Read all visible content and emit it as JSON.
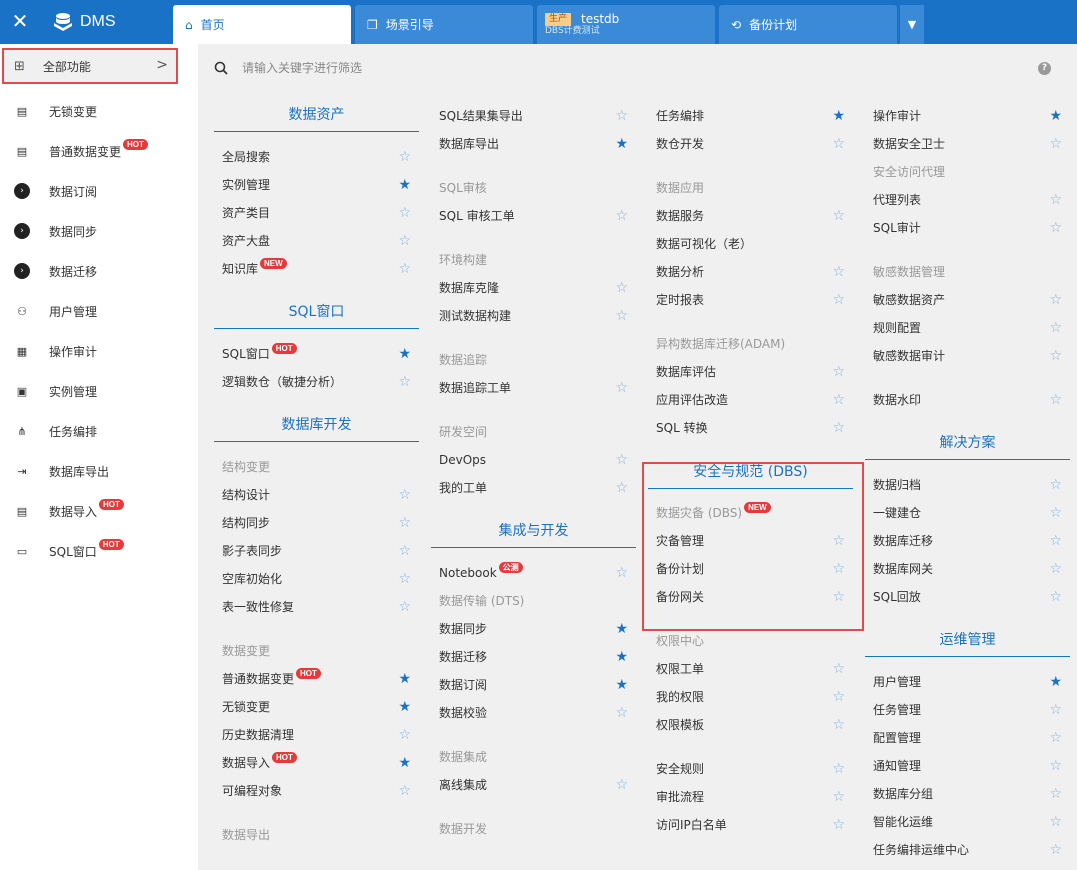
{
  "topbar": {
    "brand": "DMS",
    "tabs": [
      {
        "label": "首页"
      },
      {
        "label": "场景引导"
      },
      {
        "env": "生产",
        "label": "testdb",
        "sub": "DBS计费测试"
      },
      {
        "label": "备份计划"
      }
    ]
  },
  "sidebar": {
    "all_label": "全部功能",
    "items": [
      {
        "label": "无锁变更",
        "badge": ""
      },
      {
        "label": "普通数据变更",
        "badge": "HOT"
      },
      {
        "label": "数据订阅",
        "badge": ""
      },
      {
        "label": "数据同步",
        "badge": ""
      },
      {
        "label": "数据迁移",
        "badge": ""
      },
      {
        "label": "用户管理",
        "badge": ""
      },
      {
        "label": "操作审计",
        "badge": ""
      },
      {
        "label": "实例管理",
        "badge": ""
      },
      {
        "label": "任务编排",
        "badge": ""
      },
      {
        "label": "数据库导出",
        "badge": ""
      },
      {
        "label": "数据导入",
        "badge": "HOT"
      },
      {
        "label": "SQL窗口",
        "badge": "HOT"
      }
    ]
  },
  "search": {
    "placeholder": "请输入关键字进行筛选"
  },
  "colors": {
    "accent": "#1a72c6",
    "hot": "#e53a3a",
    "highlight_border": "#e34b4b"
  },
  "col1": {
    "h1": "数据资产",
    "r1": "全局搜索",
    "r2": "实例管理",
    "r3": "资产类目",
    "r4": "资产大盘",
    "r5": "知识库",
    "h2": "SQL窗口",
    "r6": "SQL窗口",
    "r7": "逻辑数仓（敏捷分析）",
    "h3": "数据库开发",
    "s1": "结构变更",
    "r8": "结构设计",
    "r9": "结构同步",
    "r10": "影子表同步",
    "r11": "空库初始化",
    "r12": "表一致性修复",
    "s2": "数据变更",
    "r13": "普通数据变更",
    "r14": "无锁变更",
    "r15": "历史数据清理",
    "r16": "数据导入",
    "r17": "可编程对象",
    "s3": "数据导出"
  },
  "col2": {
    "r1": "SQL结果集导出",
    "r2": "数据库导出",
    "s1": "SQL审核",
    "r3": "SQL 审核工单",
    "s2": "环境构建",
    "r4": "数据库克隆",
    "r5": "测试数据构建",
    "s3": "数据追踪",
    "r6": "数据追踪工单",
    "s4": "研发空间",
    "r7": "DevOps",
    "r8": "我的工单",
    "h1": "集成与开发",
    "r9": "Notebook",
    "r9badge": "公测",
    "s5": "数据传输 (DTS)",
    "r10": "数据同步",
    "r11": "数据迁移",
    "r12": "数据订阅",
    "r13": "数据校验",
    "s6": "数据集成",
    "r14": "离线集成",
    "s7": "数据开发"
  },
  "col3": {
    "r1": "任务编排",
    "r2": "数仓开发",
    "s1": "数据应用",
    "r3": "数据服务",
    "r4": "数据可视化（老）",
    "r5": "数据分析",
    "r6": "定时报表",
    "s2": "异构数据库迁移(ADAM)",
    "r7": "数据库评估",
    "r8": "应用评估改造",
    "r9": "SQL 转换",
    "h1": "安全与规范 (DBS)",
    "s3": "数据灾备 (DBS)",
    "r10": "灾备管理",
    "r11": "备份计划",
    "r12": "备份网关",
    "s4": "权限中心",
    "r13": "权限工单",
    "r14": "我的权限",
    "r15": "权限模板",
    "r16": "安全规则",
    "r17": "审批流程",
    "r18": "访问IP白名单"
  },
  "col4": {
    "r1": "操作审计",
    "r2": "数据安全卫士",
    "s1": "安全访问代理",
    "r3": "代理列表",
    "r4": "SQL审计",
    "s2": "敏感数据管理",
    "r5": "敏感数据资产",
    "r6": "规则配置",
    "r7": "敏感数据审计",
    "r8": "数据水印",
    "h1": "解决方案",
    "r9": "数据归档",
    "r10": "一键建仓",
    "r11": "数据库迁移",
    "r12": "数据库网关",
    "r13": "SQL回放",
    "h2": "运维管理",
    "r14": "用户管理",
    "r15": "任务管理",
    "r16": "配置管理",
    "r17": "通知管理",
    "r18": "数据库分组",
    "r19": "智能化运维",
    "r20": "任务编排运维中心"
  }
}
